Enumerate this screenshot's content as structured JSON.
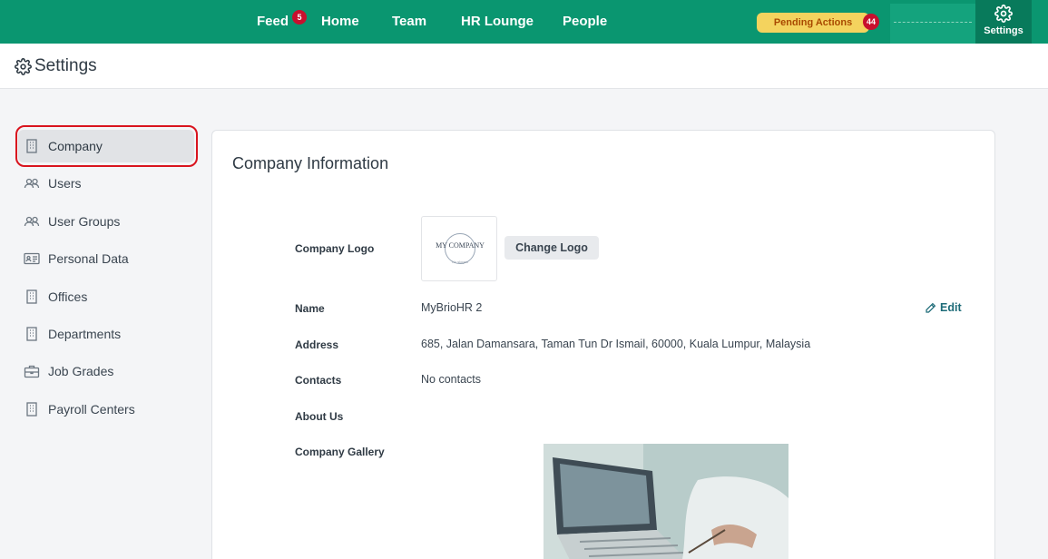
{
  "nav": {
    "links": [
      {
        "label": "Feed",
        "badge": "5"
      },
      {
        "label": "Home"
      },
      {
        "label": "Team"
      },
      {
        "label": "HR Lounge"
      },
      {
        "label": "People"
      }
    ],
    "pending_actions": {
      "label": "Pending Actions",
      "count": "44"
    },
    "settings_label": "Settings"
  },
  "page": {
    "title": "Settings"
  },
  "sidebar": {
    "items": [
      {
        "label": "Company",
        "icon": "building-icon",
        "active": true
      },
      {
        "label": "Users",
        "icon": "users-icon"
      },
      {
        "label": "User Groups",
        "icon": "users-icon"
      },
      {
        "label": "Personal Data",
        "icon": "id-card-icon"
      },
      {
        "label": "Offices",
        "icon": "building-icon"
      },
      {
        "label": "Departments",
        "icon": "building-icon"
      },
      {
        "label": "Job Grades",
        "icon": "briefcase-icon"
      },
      {
        "label": "Payroll Centers",
        "icon": "building-icon"
      }
    ]
  },
  "company": {
    "section_title": "Company Information",
    "logo_label": "Company Logo",
    "logo_text": "MY COMPANY",
    "logo_tagline": "No slogan",
    "change_logo": "Change Logo",
    "edit": "Edit",
    "name_label": "Name",
    "name_value": "MyBrioHR 2",
    "address_label": "Address",
    "address_value": "685, Jalan Damansara, Taman Tun Dr Ismail, 60000, Kuala Lumpur, Malaysia",
    "contacts_label": "Contacts",
    "contacts_value": "No contacts",
    "about_label": "About Us",
    "gallery_label": "Company Gallery"
  },
  "colors": {
    "brand_green": "#0a9670",
    "pending_yellow": "#f4d35e",
    "badge_red": "#c8102e",
    "highlight_red": "#d9141e"
  }
}
